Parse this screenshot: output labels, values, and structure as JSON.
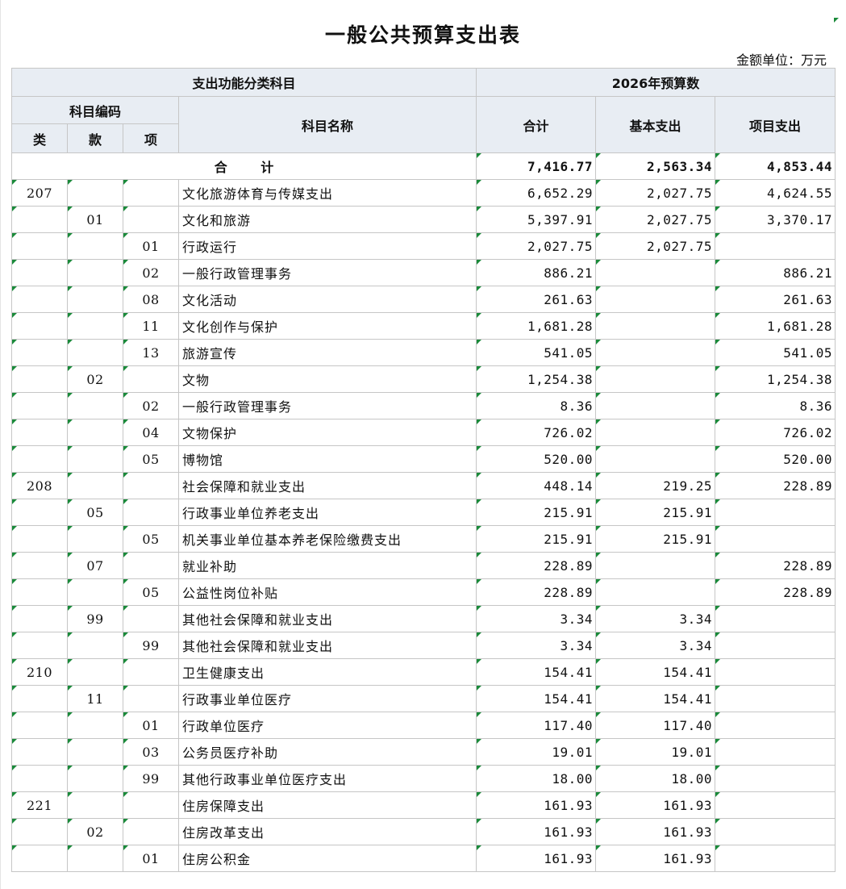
{
  "document": {
    "title": "一般公共预算支出表",
    "unit_label": "金额单位：万元"
  },
  "header": {
    "category_group": "支出功能分类科目",
    "year_group": "2026年预算数",
    "code_group": "科目编码",
    "col_lei": "类",
    "col_kuan": "款",
    "col_xiang": "项",
    "col_name": "科目名称",
    "col_total": "合计",
    "col_basic": "基本支出",
    "col_project": "项目支出"
  },
  "total_row": {
    "label": "合 计",
    "total": "7,416.77",
    "basic": "2,563.34",
    "project": "4,853.44"
  },
  "rows": [
    {
      "lei": "207",
      "kuan": "",
      "xiang": "",
      "name": "文化旅游体育与传媒支出",
      "total": "6,652.29",
      "basic": "2,027.75",
      "project": "4,624.55"
    },
    {
      "lei": "",
      "kuan": "01",
      "xiang": "",
      "name": "文化和旅游",
      "total": "5,397.91",
      "basic": "2,027.75",
      "project": "3,370.17"
    },
    {
      "lei": "",
      "kuan": "",
      "xiang": "01",
      "name": "行政运行",
      "total": "2,027.75",
      "basic": "2,027.75",
      "project": ""
    },
    {
      "lei": "",
      "kuan": "",
      "xiang": "02",
      "name": "一般行政管理事务",
      "total": "886.21",
      "basic": "",
      "project": "886.21"
    },
    {
      "lei": "",
      "kuan": "",
      "xiang": "08",
      "name": "文化活动",
      "total": "261.63",
      "basic": "",
      "project": "261.63"
    },
    {
      "lei": "",
      "kuan": "",
      "xiang": "11",
      "name": "文化创作与保护",
      "total": "1,681.28",
      "basic": "",
      "project": "1,681.28"
    },
    {
      "lei": "",
      "kuan": "",
      "xiang": "13",
      "name": "旅游宣传",
      "total": "541.05",
      "basic": "",
      "project": "541.05"
    },
    {
      "lei": "",
      "kuan": "02",
      "xiang": "",
      "name": "文物",
      "total": "1,254.38",
      "basic": "",
      "project": "1,254.38"
    },
    {
      "lei": "",
      "kuan": "",
      "xiang": "02",
      "name": "一般行政管理事务",
      "total": "8.36",
      "basic": "",
      "project": "8.36"
    },
    {
      "lei": "",
      "kuan": "",
      "xiang": "04",
      "name": "文物保护",
      "total": "726.02",
      "basic": "",
      "project": "726.02"
    },
    {
      "lei": "",
      "kuan": "",
      "xiang": "05",
      "name": "博物馆",
      "total": "520.00",
      "basic": "",
      "project": "520.00"
    },
    {
      "lei": "208",
      "kuan": "",
      "xiang": "",
      "name": "社会保障和就业支出",
      "total": "448.14",
      "basic": "219.25",
      "project": "228.89"
    },
    {
      "lei": "",
      "kuan": "05",
      "xiang": "",
      "name": "行政事业单位养老支出",
      "total": "215.91",
      "basic": "215.91",
      "project": ""
    },
    {
      "lei": "",
      "kuan": "",
      "xiang": "05",
      "name": "机关事业单位基本养老保险缴费支出",
      "total": "215.91",
      "basic": "215.91",
      "project": ""
    },
    {
      "lei": "",
      "kuan": "07",
      "xiang": "",
      "name": "就业补助",
      "total": "228.89",
      "basic": "",
      "project": "228.89"
    },
    {
      "lei": "",
      "kuan": "",
      "xiang": "05",
      "name": "公益性岗位补贴",
      "total": "228.89",
      "basic": "",
      "project": "228.89"
    },
    {
      "lei": "",
      "kuan": "99",
      "xiang": "",
      "name": "其他社会保障和就业支出",
      "total": "3.34",
      "basic": "3.34",
      "project": ""
    },
    {
      "lei": "",
      "kuan": "",
      "xiang": "99",
      "name": "其他社会保障和就业支出",
      "total": "3.34",
      "basic": "3.34",
      "project": ""
    },
    {
      "lei": "210",
      "kuan": "",
      "xiang": "",
      "name": "卫生健康支出",
      "total": "154.41",
      "basic": "154.41",
      "project": ""
    },
    {
      "lei": "",
      "kuan": "11",
      "xiang": "",
      "name": "行政事业单位医疗",
      "total": "154.41",
      "basic": "154.41",
      "project": ""
    },
    {
      "lei": "",
      "kuan": "",
      "xiang": "01",
      "name": "行政单位医疗",
      "total": "117.40",
      "basic": "117.40",
      "project": ""
    },
    {
      "lei": "",
      "kuan": "",
      "xiang": "03",
      "name": "公务员医疗补助",
      "total": "19.01",
      "basic": "19.01",
      "project": ""
    },
    {
      "lei": "",
      "kuan": "",
      "xiang": "99",
      "name": "其他行政事业单位医疗支出",
      "total": "18.00",
      "basic": "18.00",
      "project": ""
    },
    {
      "lei": "221",
      "kuan": "",
      "xiang": "",
      "name": "住房保障支出",
      "total": "161.93",
      "basic": "161.93",
      "project": ""
    },
    {
      "lei": "",
      "kuan": "02",
      "xiang": "",
      "name": "住房改革支出",
      "total": "161.93",
      "basic": "161.93",
      "project": ""
    },
    {
      "lei": "",
      "kuan": "",
      "xiang": "01",
      "name": "住房公积金",
      "total": "161.93",
      "basic": "161.93",
      "project": ""
    }
  ]
}
